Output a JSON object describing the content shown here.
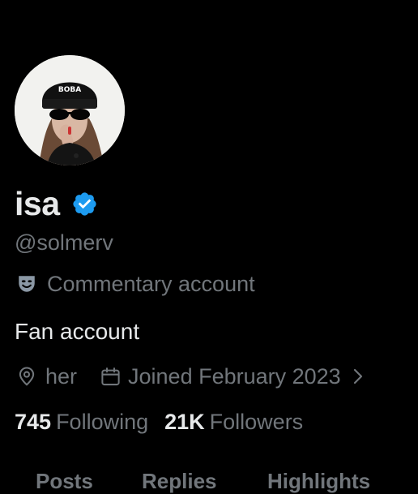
{
  "profile": {
    "display_name": "isa",
    "handle": "@solmerv",
    "label": "Commentary account",
    "bio": "Fan account",
    "pronouns": "her",
    "joined": "Joined February 2023",
    "following_count": "745",
    "following_label": "Following",
    "followers_count": "21K",
    "followers_label": "Followers",
    "avatar_cap_text": "BOBA"
  },
  "tabs": [
    "Posts",
    "Replies",
    "Highlights"
  ],
  "icons": {
    "verified": "verified-badge-icon",
    "label": "theater-mask-icon",
    "location": "location-pin-icon",
    "calendar": "calendar-icon",
    "chevron": "chevron-right-icon"
  },
  "colors": {
    "background": "#000000",
    "primary_text": "#e7e9ea",
    "secondary_text": "#71767b",
    "verified_blue": "#1d9bf0"
  }
}
